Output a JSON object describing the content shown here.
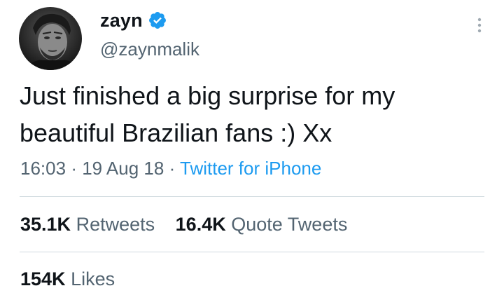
{
  "author": {
    "display_name": "zayn",
    "handle": "@zaynmalik",
    "verified": true,
    "avatar_icon": "profile-photo"
  },
  "tweet": {
    "text_line1": "Just finished a big surprise for my",
    "text_line2": "beautiful Brazilian fans :) Xx",
    "time": "16:03",
    "date": "19 Aug 18",
    "separator": "·",
    "source": "Twitter for iPhone"
  },
  "stats": {
    "retweets_count": "35.1K",
    "retweets_label": "Retweets",
    "quotes_count": "16.4K",
    "quotes_label": "Quote Tweets",
    "likes_count": "154K",
    "likes_label": "Likes"
  },
  "icons": {
    "verified": "verified-badge-icon",
    "more": "more-vertical-icon"
  },
  "colors": {
    "text_primary": "#0f1419",
    "text_secondary": "#536471",
    "link": "#1d9bf0",
    "verified": "#1d9bf0",
    "divider": "#cfd9de"
  }
}
